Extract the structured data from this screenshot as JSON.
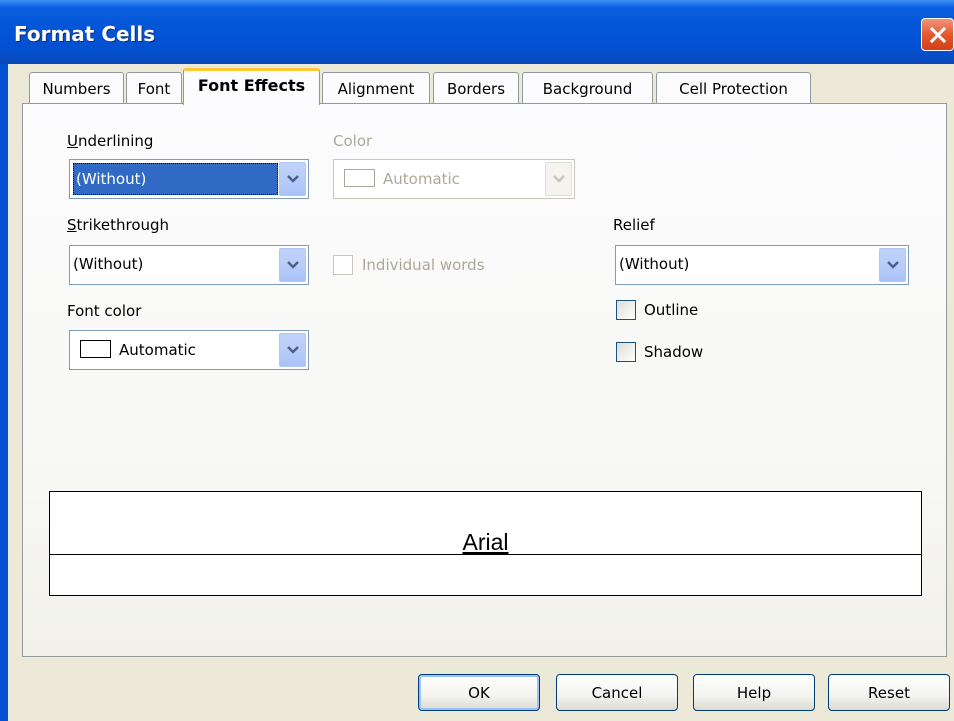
{
  "window": {
    "title": "Format Cells",
    "close_icon": "close-icon"
  },
  "tabs": [
    {
      "label": "Numbers"
    },
    {
      "label": "Font"
    },
    {
      "label": "Font Effects",
      "active": true
    },
    {
      "label": "Alignment"
    },
    {
      "label": "Borders"
    },
    {
      "label": "Background"
    },
    {
      "label": "Cell Protection"
    }
  ],
  "underlining": {
    "label": "Underlining",
    "accel": "U",
    "value": "(Without)"
  },
  "color": {
    "label": "Color",
    "value": "Automatic",
    "enabled": false
  },
  "strikethrough": {
    "label": "Strikethrough",
    "accel": "S",
    "value": "(Without)"
  },
  "individual_words": {
    "label": "Individual words",
    "checked": false,
    "enabled": false
  },
  "relief": {
    "label": "Relief",
    "value": "(Without)"
  },
  "font_color": {
    "label": "Font color",
    "value": "Automatic"
  },
  "outline": {
    "label": "Outline",
    "checked": false
  },
  "shadow": {
    "label": "Shadow",
    "checked": false
  },
  "preview": {
    "text": "Arial"
  },
  "buttons": {
    "ok": "OK",
    "cancel": "Cancel",
    "help": "Help",
    "reset": "Reset"
  },
  "colors": {
    "titlebar": "#0354d6",
    "dialog_bg": "#ece9d8",
    "selection": "#316ac5",
    "tab_highlight": "#ffc83c"
  }
}
